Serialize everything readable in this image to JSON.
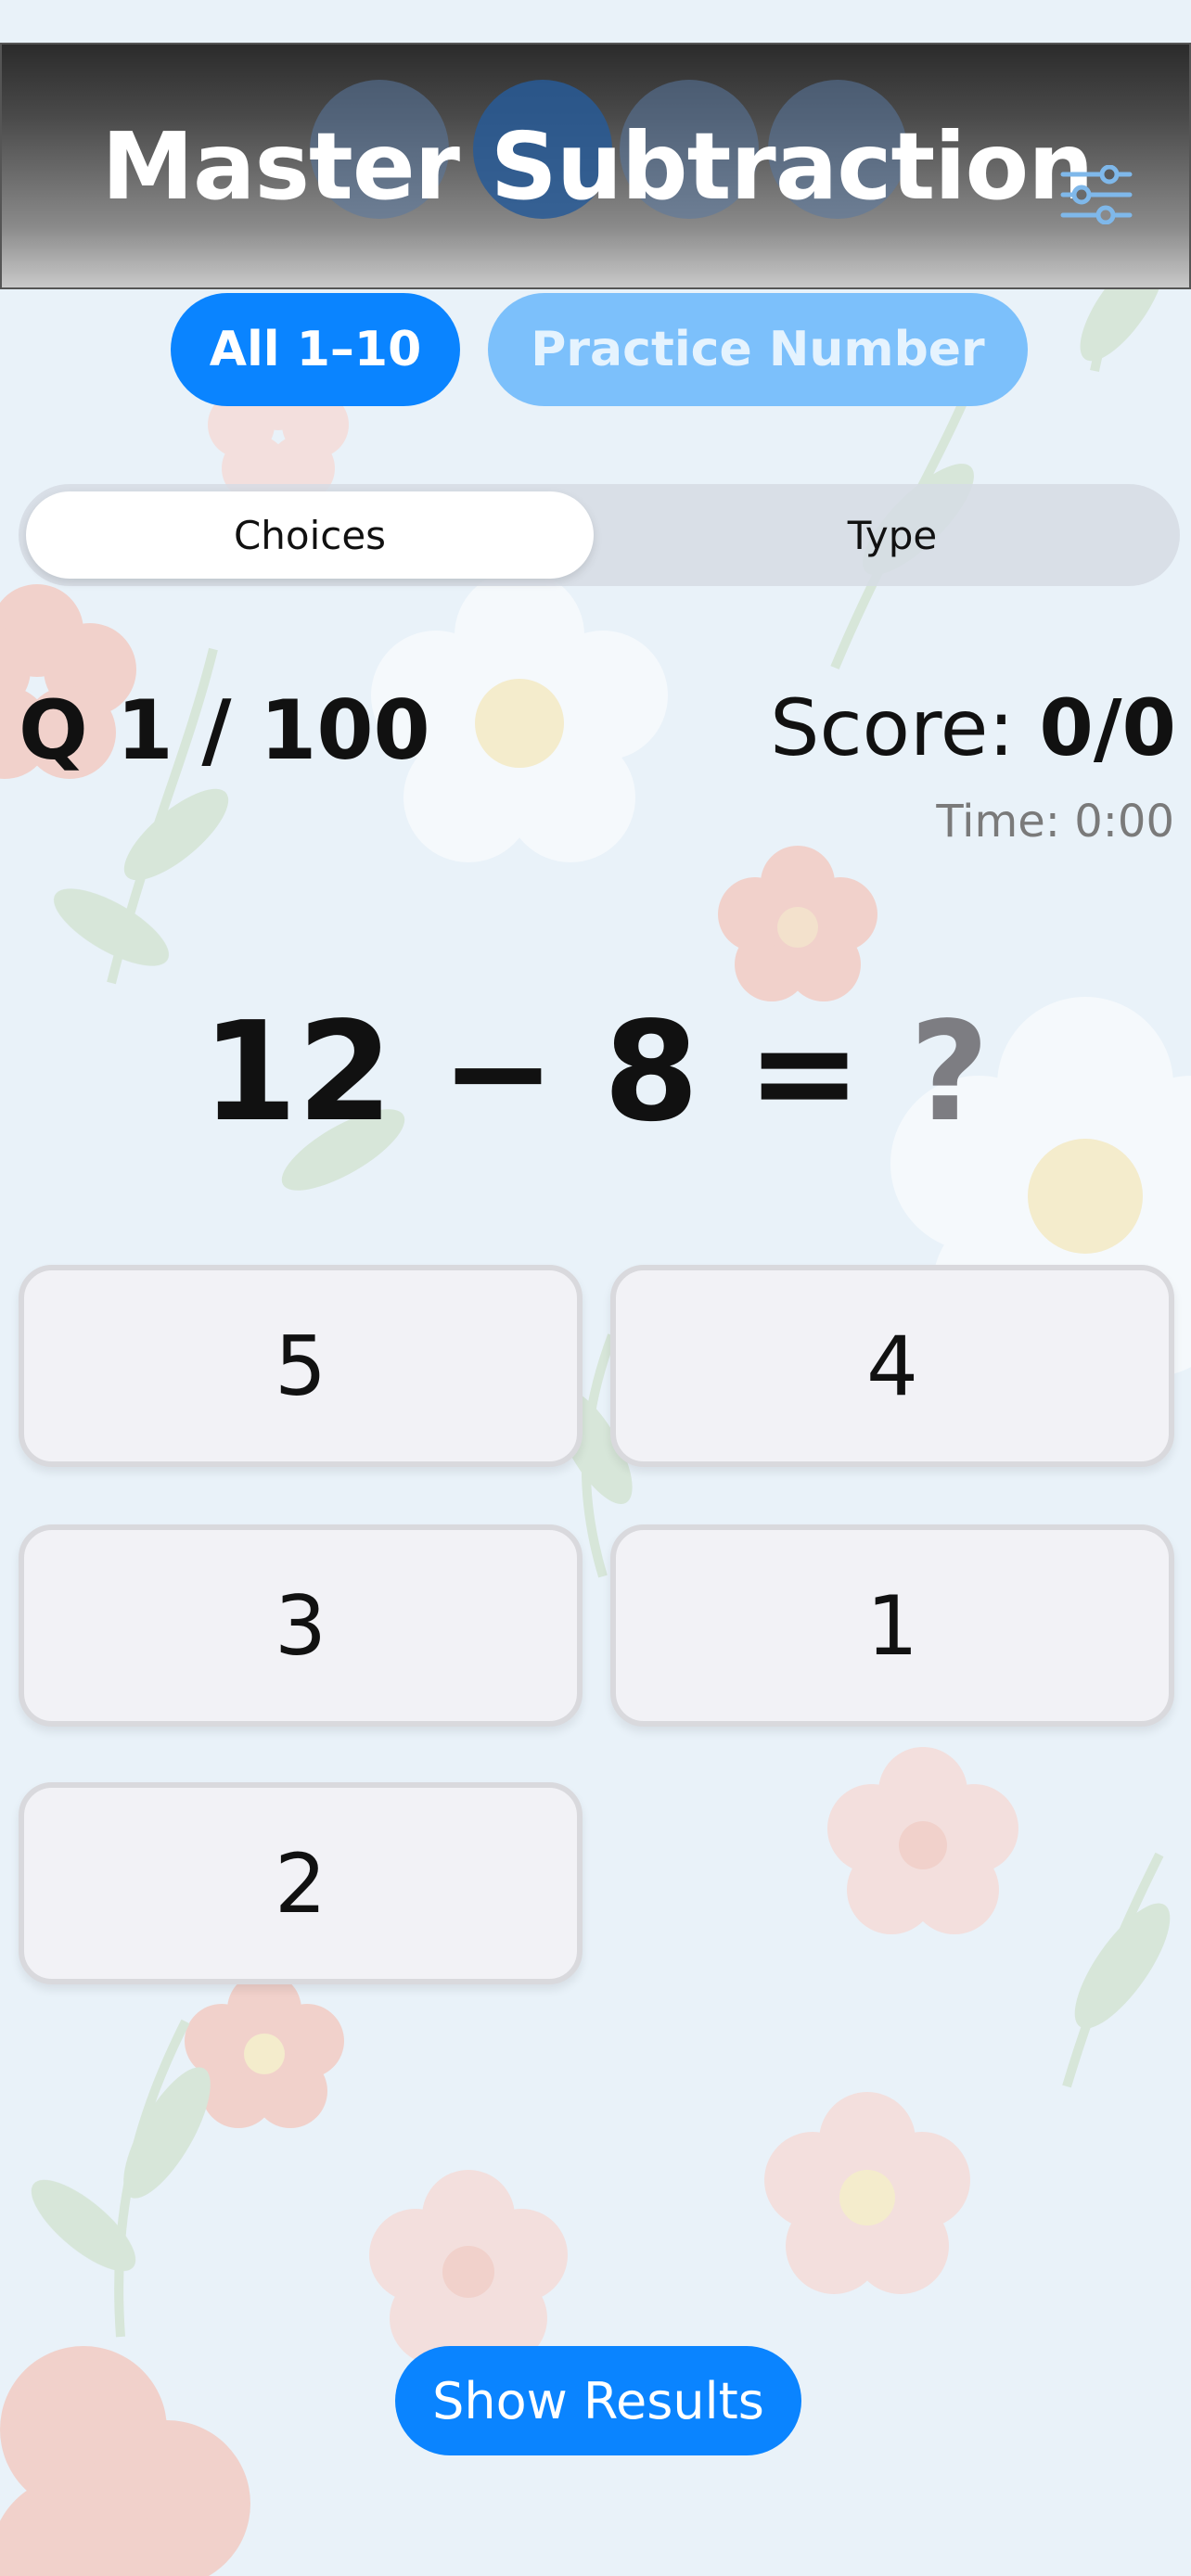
{
  "header": {
    "title": "Master Subtraction",
    "settings_icon": "sliders-icon"
  },
  "mode_pills": {
    "all_label": "All 1–10",
    "practice_label": "Practice Number"
  },
  "input_mode": {
    "choices_label": "Choices",
    "type_label": "Type",
    "selected": "Choices"
  },
  "status": {
    "question_counter": "Q 1 / 100",
    "score_label": "Score:",
    "score_value": "0/0",
    "time": "Time: 0:00"
  },
  "problem": {
    "left": "12 − 8 =",
    "unknown": "?"
  },
  "choices": [
    {
      "label": "5"
    },
    {
      "label": "4"
    },
    {
      "label": "3"
    },
    {
      "label": "1"
    },
    {
      "label": "2"
    }
  ],
  "footer": {
    "show_results_label": "Show Results"
  },
  "colors": {
    "accent": "#0a84ff",
    "accent_light": "#7cc0fb",
    "background": "#e8f1f8"
  }
}
